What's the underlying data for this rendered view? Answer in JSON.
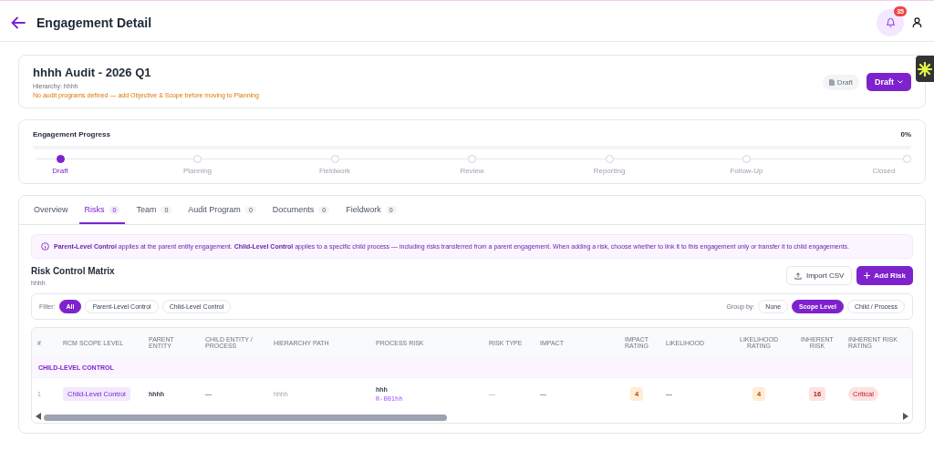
{
  "header": {
    "title": "Engagement Detail",
    "notification_count": "35"
  },
  "engagement": {
    "title": "hhhh Audit - 2026 Q1",
    "hierarchy": "Hierarchy: hhhh",
    "warning": "No audit programs defined — add Objective & Scope before moving to Planning",
    "status_badge": "Draft",
    "status_button": "Draft"
  },
  "progress": {
    "title": "Engagement Progress",
    "percent": "0%",
    "stages": [
      {
        "label": "Draft",
        "selected": true
      },
      {
        "label": "Planning",
        "selected": false
      },
      {
        "label": "Fieldwork",
        "selected": false
      },
      {
        "label": "Review",
        "selected": false
      },
      {
        "label": "Reporting",
        "selected": false
      },
      {
        "label": "Follow-Up",
        "selected": false
      },
      {
        "label": "Closed",
        "selected": false
      }
    ]
  },
  "tabs": [
    {
      "label": "Overview",
      "selected": false
    },
    {
      "label": "Risks",
      "count": "0",
      "selected": true
    },
    {
      "label": "Team",
      "count": "0",
      "selected": false
    },
    {
      "label": "Audit Program",
      "count": "0",
      "selected": false
    },
    {
      "label": "Documents",
      "count": "0",
      "selected": false
    },
    {
      "label": "Fieldwork",
      "count": "0",
      "selected": false
    }
  ],
  "info": "**Parent-Level Control** applies at the parent entity engagement. **Child-Level Control** applies to a specific child process — including risks transferred from a parent engagement. When adding a risk, choose whether to link it to this engagement only or transfer it to child engagements.",
  "matrix": {
    "title": "Risk Control Matrix",
    "subtitle": "hhhh",
    "buttons": [
      {
        "label": "Import CSV",
        "kind": "outline"
      },
      {
        "label": "Add Risk",
        "kind": "primary"
      }
    ]
  },
  "filter": {
    "label": "Filter:",
    "options": [
      {
        "label": "All",
        "selected": true
      },
      {
        "label": "Parent-Level Control",
        "selected": false
      },
      {
        "label": "Child-Level Control",
        "selected": false
      }
    ]
  },
  "group_by": {
    "label": "Group by:",
    "options": [
      {
        "label": "None",
        "selected": false
      },
      {
        "label": "Scope Level",
        "selected": true
      },
      {
        "label": "Child / Process",
        "selected": false
      }
    ]
  },
  "table": {
    "columns": [
      "#",
      "RCM SCOPE LEVEL",
      "PARENT ENTITY",
      "CHILD ENTITY / PROCESS",
      "HIERARCHY PATH",
      "PROCESS RISK",
      "RISK TYPE",
      "IMPACT",
      "IMPACT RATING",
      "LIKELIHOOD",
      "LIKELIHOOD RATING",
      "INHERENT RISK",
      "INHERENT RISK RATING"
    ],
    "groups": [
      {
        "label": "CHILD-LEVEL CONTROL",
        "rows": [
          {
            "number": "1",
            "scope": "Child-Level Control",
            "parent_entity": "hhhh",
            "child_entity": "—",
            "hierarchy_path": "hhhh",
            "process_risk": "hhh",
            "risk_code": "R-001hh",
            "risk_type": "—",
            "impact": "—",
            "impact_rating": "4",
            "likelihood": "—",
            "likelihood_rating": "4",
            "inherent_risk": "16",
            "inherent_risk_rating": "Critical"
          }
        ]
      }
    ]
  }
}
